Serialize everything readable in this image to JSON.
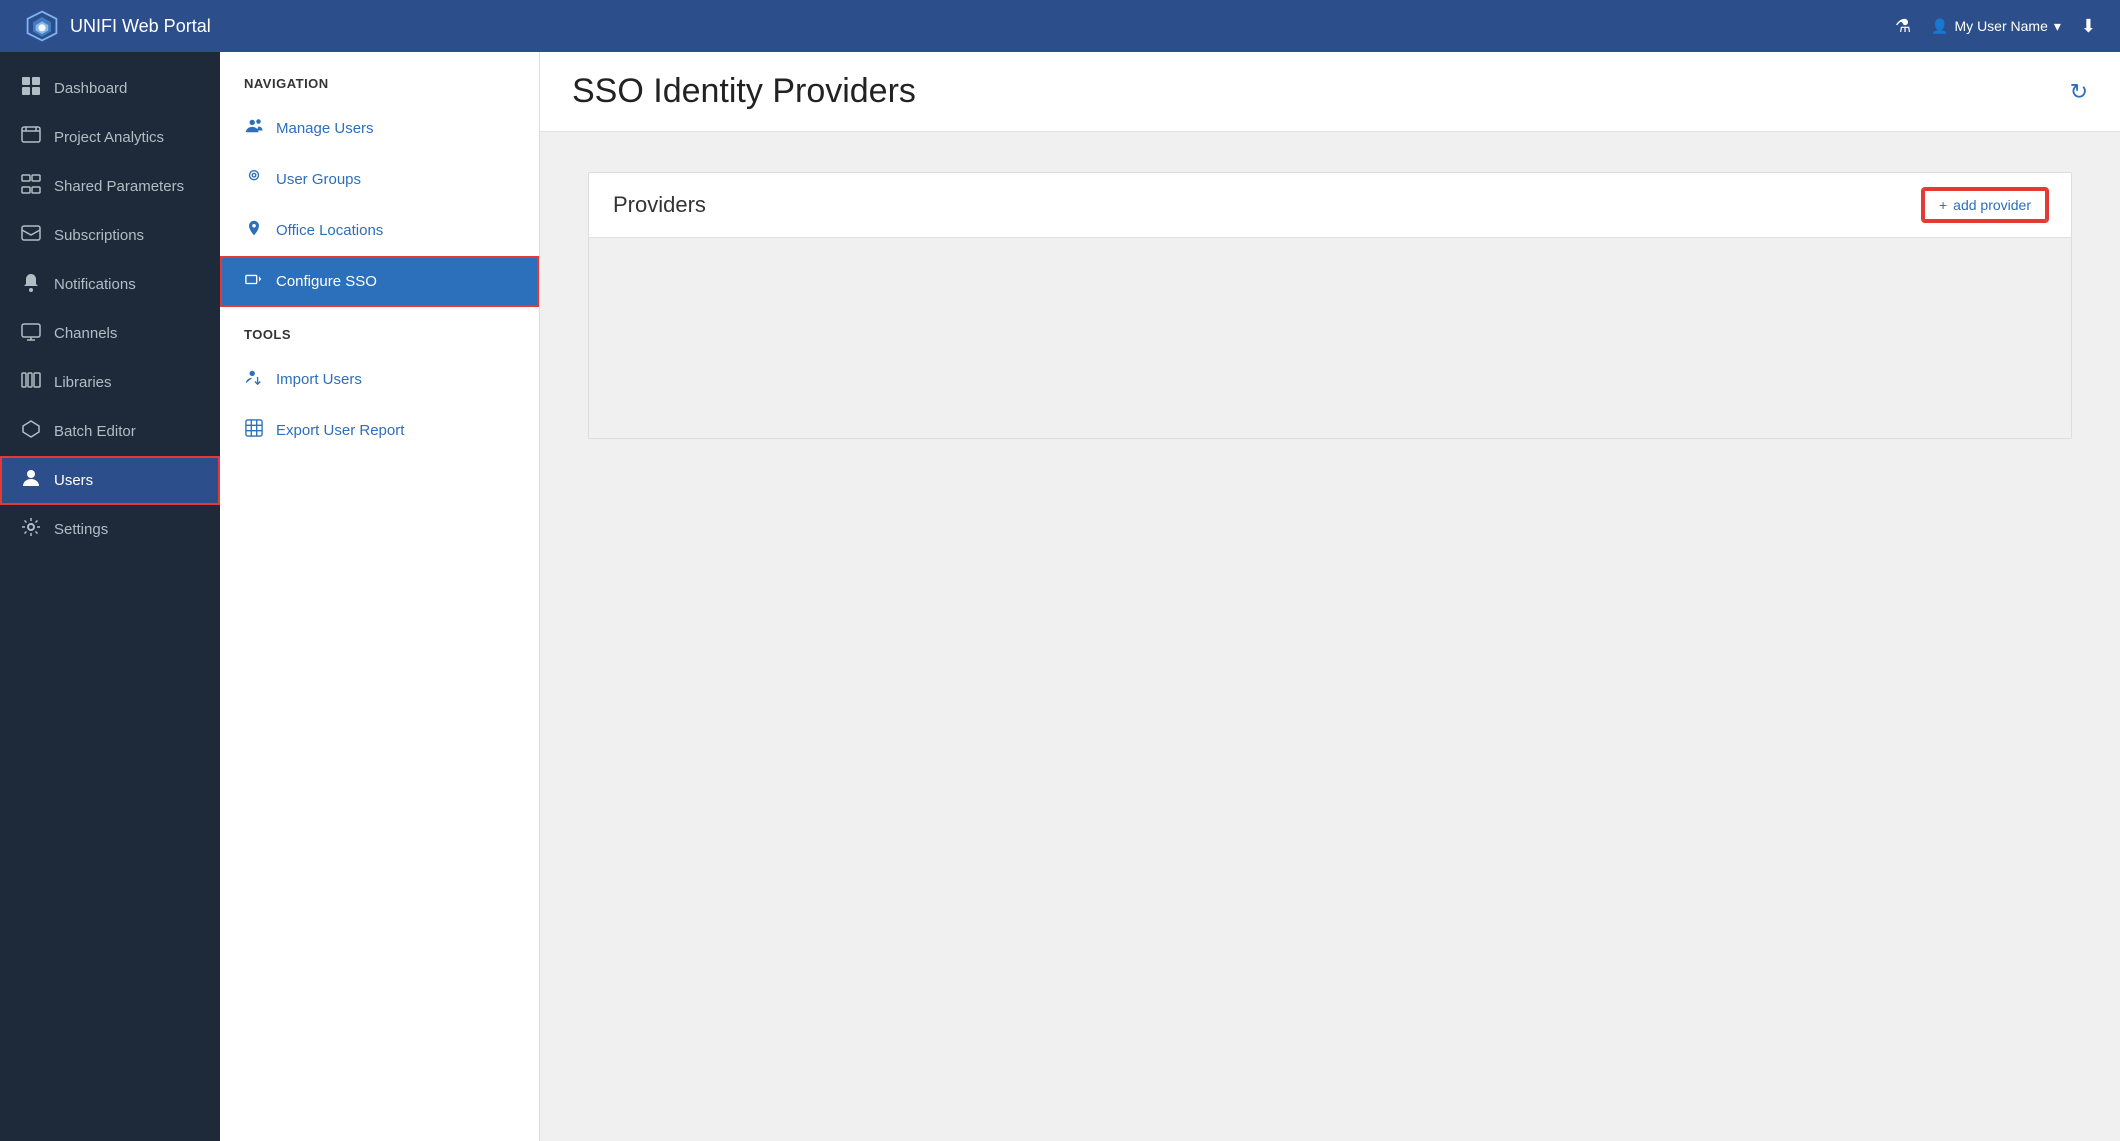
{
  "header": {
    "app_name": "UNIFI Web Portal",
    "user_name": "My User Name",
    "icons": {
      "flask": "⚗",
      "download": "⬇",
      "chevron_down": "▾"
    }
  },
  "sidebar": {
    "items": [
      {
        "id": "dashboard",
        "label": "Dashboard",
        "icon": "🎨",
        "active": false
      },
      {
        "id": "project-analytics",
        "label": "Project Analytics",
        "icon": "📖",
        "active": false
      },
      {
        "id": "shared-parameters",
        "label": "Shared Parameters",
        "icon": "⊞",
        "active": false
      },
      {
        "id": "subscriptions",
        "label": "Subscriptions",
        "icon": "🔔",
        "active": false
      },
      {
        "id": "notifications",
        "label": "Notifications",
        "icon": "📢",
        "active": false
      },
      {
        "id": "channels",
        "label": "Channels",
        "icon": "🖥",
        "active": false
      },
      {
        "id": "libraries",
        "label": "Libraries",
        "icon": "🗂",
        "active": false
      },
      {
        "id": "batch-editor",
        "label": "Batch Editor",
        "icon": "🏷",
        "active": false
      },
      {
        "id": "users",
        "label": "Users",
        "icon": "👤",
        "active": true,
        "highlighted": true
      },
      {
        "id": "settings",
        "label": "Settings",
        "icon": "⚙",
        "active": false
      }
    ]
  },
  "navigation": {
    "title": "NAVIGATION",
    "items": [
      {
        "id": "manage-users",
        "label": "Manage Users",
        "icon": "👥",
        "active": false
      },
      {
        "id": "user-groups",
        "label": "User Groups",
        "icon": "👁",
        "active": false
      },
      {
        "id": "office-locations",
        "label": "Office Locations",
        "icon": "📍",
        "active": false
      },
      {
        "id": "configure-sso",
        "label": "Configure SSO",
        "icon": "→",
        "active": true,
        "highlighted": true
      }
    ],
    "tools_title": "TOOLS",
    "tools": [
      {
        "id": "import-users",
        "label": "Import Users",
        "icon": "👤+"
      },
      {
        "id": "export-user-report",
        "label": "Export User Report",
        "icon": "⊞"
      }
    ]
  },
  "main": {
    "page_title": "SSO Identity Providers",
    "providers_section_title": "Providers",
    "add_provider_label": "add provider",
    "add_provider_icon": "+"
  }
}
